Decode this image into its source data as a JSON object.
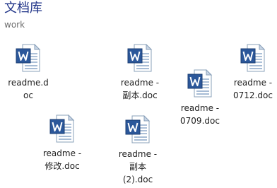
{
  "library": {
    "title": "文档库",
    "subtitle": "work"
  },
  "icons": {
    "file": "word-document-icon",
    "accent": "#2b579a",
    "page": "#ffffff",
    "fold": "#c9d6e6"
  },
  "files": [
    {
      "line1": "readme.d",
      "line2": "oc",
      "line3": ""
    },
    {
      "line1": "readme -",
      "line2": "副本.doc",
      "line3": ""
    },
    {
      "line1": "readme -",
      "line2": "0709.doc",
      "line3": ""
    },
    {
      "line1": "readme -",
      "line2": "0712.doc",
      "line3": ""
    },
    {
      "line1": "readme -",
      "line2": "修改.doc",
      "line3": ""
    },
    {
      "line1": "readme -",
      "line2": "副本",
      "line3": "(2).doc"
    }
  ]
}
